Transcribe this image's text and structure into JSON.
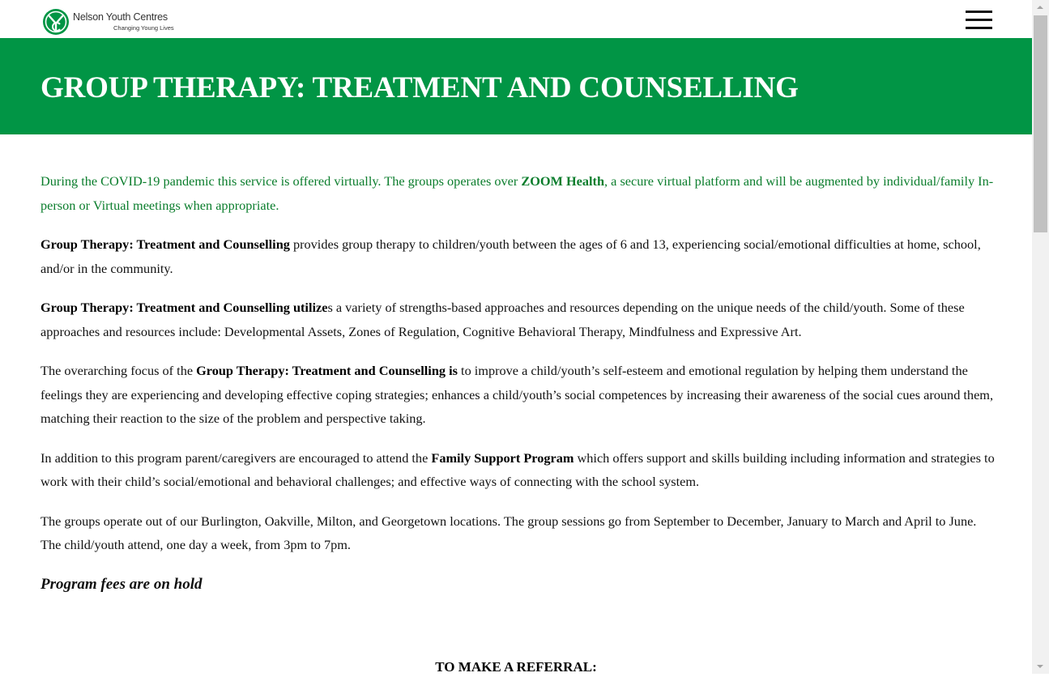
{
  "header": {
    "logo_name": "Nelson Youth Centres",
    "logo_tagline": "Changing Young Lives",
    "brand_color": "#019545",
    "menu_icon": "hamburger-menu-icon"
  },
  "hero": {
    "title": "GROUP THERAPY: TREATMENT AND COUNSELLING"
  },
  "content": {
    "covid": {
      "part1": "During the COVID-19 pandemic this service is offered virtually. The groups operates over ",
      "bold": "ZOOM Health",
      "part2": ", a secure virtual platform and will be augmented by individual/family In-person or Virtual meetings when appropriate."
    },
    "intro": {
      "bold": "Group Therapy: Treatment and Counselling",
      "rest": " provides group therapy to children/youth between the ages of 6 and 13, experiencing social/emotional difficulties at home, school, and/or in the community."
    },
    "approaches": {
      "bold": "Group Therapy: Treatment and Counselling utilize",
      "rest": "s a variety of strengths-based approaches and resources depending on the unique needs of the child/youth. Some of these approaches and resources include: Developmental Assets, Zones of Regulation, Cognitive Behavioral Therapy, Mindfulness and Expressive Art."
    },
    "focus": {
      "part1": "The overarching focus of the ",
      "bold": "Group Therapy: Treatment and Counselling is",
      "rest": " to improve a child/youth’s self-esteem and emotional regulation by helping them under­stand the feelings they are experiencing and developing effective coping strategies; enhances a child/youth’s social competences by increasing their awareness of the social cues around them, matching their reaction to the size of the problem and perspective taking."
    },
    "family": {
      "part1": "In addition to this program parent/caregivers are encouraged to attend the ",
      "bold": "Family Support Program",
      "rest": " which offers support and skills building including information and strategies to work with their child’s social/emotional and behavioral challenges; and effective ways of connecting with the school system."
    },
    "locations": "The groups operate out of our Burlington, Oakville, Milton, and Georgetown locations. The group sessions go from September to December, January to March and April to June. The child/youth attend, one day a week, from 3pm to 7pm.",
    "fees": "Program fees are on hold",
    "referral_heading": "TO MAKE A REFERRAL:"
  }
}
